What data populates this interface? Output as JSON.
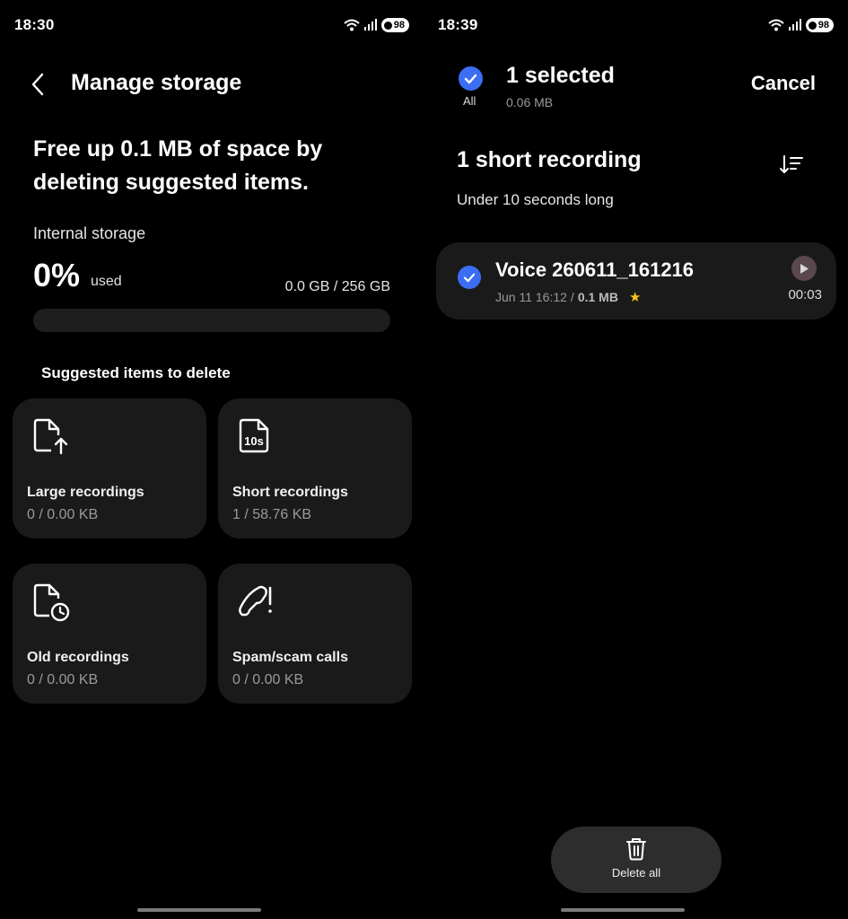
{
  "left": {
    "status": {
      "time": "18:30",
      "battery": "98"
    },
    "title": "Manage storage",
    "headline": "Free up 0.1 MB of space by deleting suggested items.",
    "storage_label": "Internal storage",
    "percent": "0%",
    "used_label": "used",
    "capacity": "0.0 GB / 256 GB",
    "usage_fraction": 0.0,
    "suggested_header": "Suggested items to delete",
    "cards": [
      {
        "label": "Large recordings",
        "sub": "0 / 0.00 KB",
        "icon": "file-upload-icon"
      },
      {
        "label": "Short recordings",
        "sub": "1 / 58.76 KB",
        "icon": "10s-file-icon"
      },
      {
        "label": "Old recordings",
        "sub": "0 / 0.00 KB",
        "icon": "file-clock-icon"
      },
      {
        "label": "Spam/scam calls",
        "sub": "0 / 0.00 KB",
        "icon": "phone-warning-icon"
      }
    ],
    "icon_badge": "10s"
  },
  "right": {
    "status": {
      "time": "18:39",
      "battery": "98"
    },
    "select_all_label": "All",
    "selected_count": "1 selected",
    "selected_size": "0.06 MB",
    "cancel_label": "Cancel",
    "section_title": "1 short recording",
    "section_sub": "Under 10 seconds long",
    "recording": {
      "name": "Voice 260611_161216",
      "date": "Jun 11 16:12",
      "separator": "/",
      "size": "0.1 MB",
      "duration": "00:03",
      "starred": true
    },
    "delete_label": "Delete all"
  },
  "colors": {
    "accent": "#3b6ef5",
    "card": "#1a1a1a",
    "star": "#f5c518"
  }
}
